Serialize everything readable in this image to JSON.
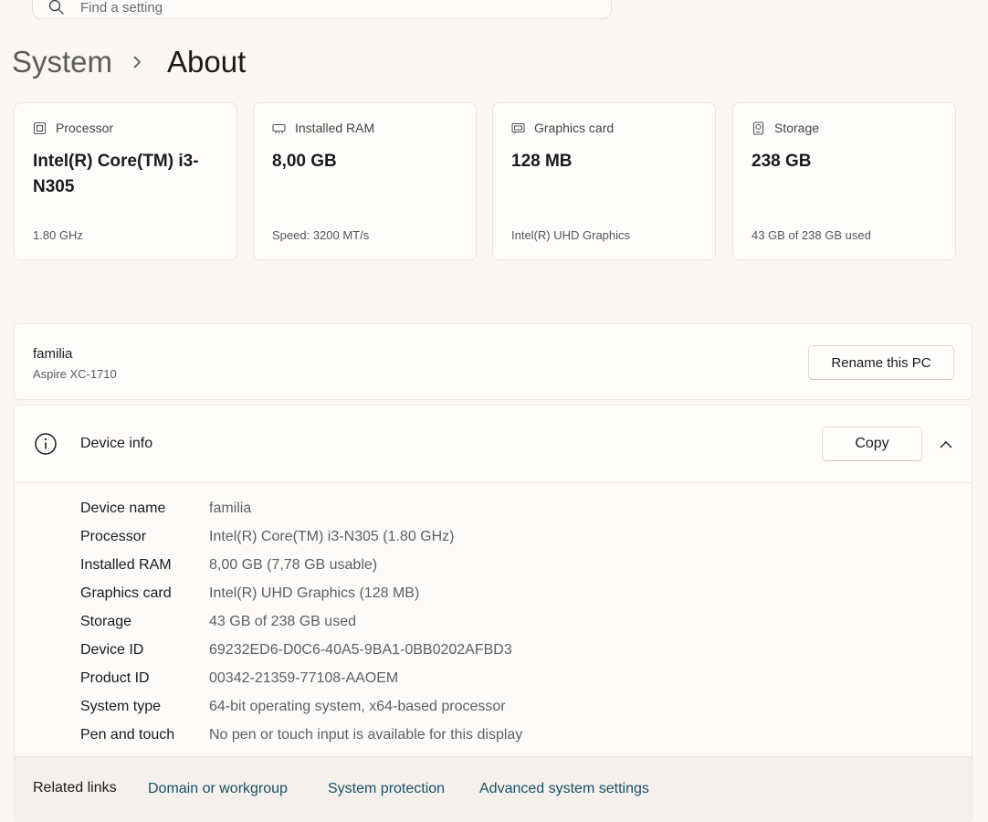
{
  "search": {
    "placeholder": "Find a setting"
  },
  "breadcrumb": {
    "parent": "System",
    "current": "About"
  },
  "cards": [
    {
      "icon": "processor-icon",
      "label": "Processor",
      "value": "Intel(R) Core(TM) i3-N305",
      "sub": "1.80 GHz"
    },
    {
      "icon": "ram-icon",
      "label": "Installed RAM",
      "value": "8,00 GB",
      "sub": "Speed: 3200 MT/s"
    },
    {
      "icon": "graphics-card-icon",
      "label": "Graphics card",
      "value": "128 MB",
      "sub": "Intel(R) UHD Graphics"
    },
    {
      "icon": "storage-icon",
      "label": "Storage",
      "value": "238 GB",
      "sub": "43 GB of 238 GB used"
    }
  ],
  "pc": {
    "name": "familia",
    "model": "Aspire XC-1710",
    "rename_label": "Rename this PC"
  },
  "device_info": {
    "title": "Device info",
    "copy_label": "Copy",
    "rows": [
      {
        "key": "Device name",
        "value": "familia"
      },
      {
        "key": "Processor",
        "value": "Intel(R) Core(TM) i3-N305 (1.80 GHz)"
      },
      {
        "key": "Installed RAM",
        "value": "8,00 GB (7,78 GB usable)"
      },
      {
        "key": "Graphics card",
        "value": "Intel(R) UHD Graphics (128 MB)"
      },
      {
        "key": "Storage",
        "value": "43 GB of 238 GB used"
      },
      {
        "key": "Device ID",
        "value": "69232ED6-D0C6-40A5-9BA1-0BB0202AFBD3"
      },
      {
        "key": "Product ID",
        "value": "00342-21359-77108-AAOEM"
      },
      {
        "key": "System type",
        "value": "64-bit operating system, x64-based processor"
      },
      {
        "key": "Pen and touch",
        "value": "No pen or touch input is available for this display"
      }
    ]
  },
  "related": {
    "label": "Related links",
    "links": [
      "Domain or workgroup",
      "System protection",
      "Advanced system settings"
    ]
  },
  "colors": {
    "link": "#1b4f63",
    "background": "#f9f6f3",
    "card": "#fffdfb"
  }
}
